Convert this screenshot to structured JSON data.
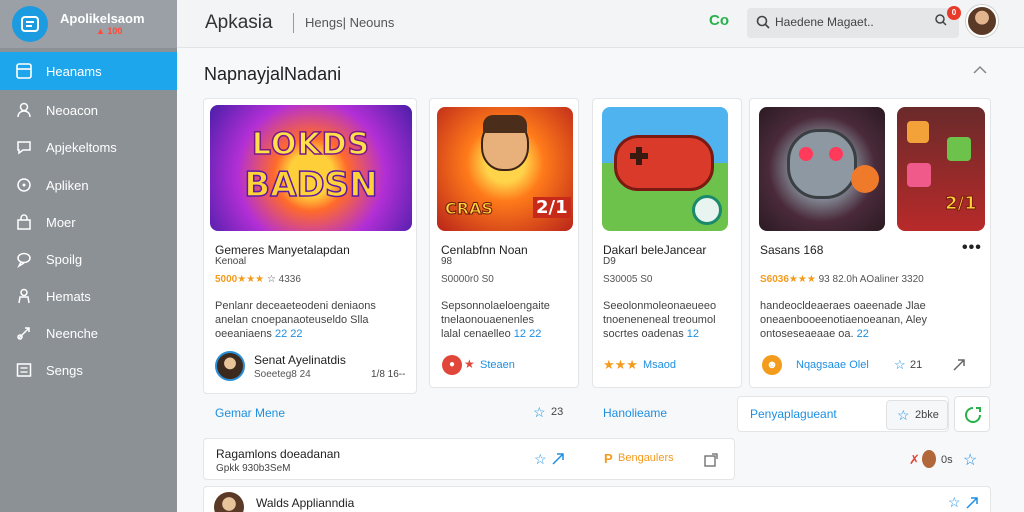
{
  "brand": {
    "title": "Apolikelsaom",
    "subtitle": "▲ 100"
  },
  "sidebar": {
    "items": [
      {
        "label": "Heanams",
        "icon": "grid-icon",
        "active": true
      },
      {
        "label": "Neoacon",
        "icon": "user-icon"
      },
      {
        "label": "Apjekeltoms",
        "icon": "chat-icon"
      },
      {
        "label": "Apliken",
        "icon": "circle-icon"
      },
      {
        "label": "Moer",
        "icon": "bag-icon"
      },
      {
        "label": "Spoilg",
        "icon": "speech-icon"
      },
      {
        "label": "Hemats",
        "icon": "person-icon"
      },
      {
        "label": "Neenche",
        "icon": "link-icon"
      },
      {
        "label": "Sengs",
        "icon": "settings-list-icon"
      }
    ]
  },
  "header": {
    "app_title": "Apkasia",
    "breadcrumb": "Hengs| Neouns",
    "status_text": "Co",
    "search_placeholder": "Haedene Magaet..",
    "notification_count": "0"
  },
  "main": {
    "section_title": "NapnayjalNadani",
    "cards": [
      {
        "thumb_text_1": "LOKDS",
        "thumb_text_2": "BADSN",
        "title": "Gemeres Manyetalapdan",
        "subtitle": "Kenoal",
        "rating_stars": "★★★",
        "rating_prefix": "5000",
        "rating_text": "☆ 4336",
        "desc_1": "Penlanr deceaeteodeni deniaons",
        "desc_2": "anelan cnoepanaoteuseldo Slla",
        "desc_3": "oeeaniaens",
        "desc_link": "22 22",
        "author_name": "Senat Ayelinatdis",
        "author_meta": "Soeeteg8 24",
        "author_extra": "1/8 16--",
        "footer_label": "Gemar Mene",
        "footer_count": "23"
      },
      {
        "thumb_text_1": "CRAS",
        "thumb_text_2": "2/1",
        "title": "Cenlabfnn Noan",
        "subtitle": "98",
        "rating_text": "S0000r0 S0",
        "desc_1": "Sepsonnolaeloengaite",
        "desc_2": "tnelaonouaenenles",
        "desc_3": "lalal cenaelleo",
        "desc_link": "12 22",
        "author_name": "Steaen",
        "footer_label": ""
      },
      {
        "title": "Dakarl beleJancear",
        "subtitle": "D9",
        "rating_text": "S30005 S0",
        "desc_1": "Seeolonmoleonaeueeo",
        "desc_2": "tnoeneneneal treoumol",
        "desc_3": "socrtes oadenas",
        "desc_link": "12",
        "author_name": "Msaod",
        "rating_stars_author": "★★★",
        "footer_label": "Hanolieame"
      },
      {
        "thumb_text": "2/1",
        "title": "Sasans 168",
        "rating_stars": "★★★",
        "rating_prefix": "S6036",
        "rating_text": "93 82.0h AOaliner 3320",
        "desc_1": "handeocldeaeraes oaeenade Jlae",
        "desc_2": "oneaenbooeenotiaenoeanan, Aley",
        "desc_3": "ontoseseaeaae oa.",
        "desc_link": "22",
        "author_name": "Nqagsaae Olel",
        "author_count": "21",
        "footer_label": "Penyaplagueant",
        "footer_count": "2bke"
      }
    ],
    "list_rows": [
      {
        "title": "Ragamlons doeadanan",
        "meta": "Gpkk 930b3SeM",
        "tag_label": "Bengaulers"
      },
      {
        "title": "Walds Applianndia"
      }
    ],
    "row_right_count": "0s"
  },
  "colors": {
    "accent": "#1ea6ec",
    "sidebar_bg": "#8c9196",
    "star": "#f39b1d",
    "link": "#1e8fe0",
    "danger": "#e0463a",
    "success": "#27b14b"
  }
}
